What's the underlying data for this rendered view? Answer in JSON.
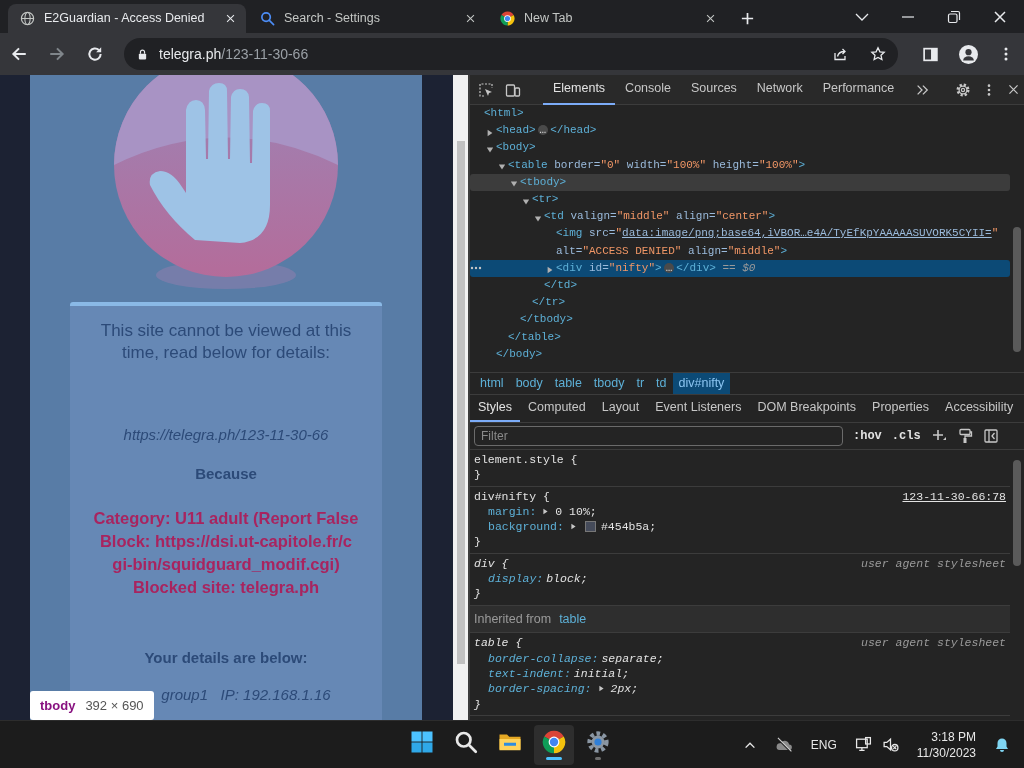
{
  "browser_tabs": [
    {
      "title": "E2Guardian - Access Denied",
      "selected": true
    },
    {
      "title": "Search - Settings",
      "selected": false
    },
    {
      "title": "New Tab",
      "selected": false
    }
  ],
  "address_bar": {
    "host": "telegra.ph",
    "path": "/123-11-30-66"
  },
  "page": {
    "message": "This site cannot be viewed at this time, read below for details:",
    "url": "https://telegra.ph/123-11-30-66",
    "because": "Because",
    "reason_lines": [
      "Category: U11 adult (Report False",
      "Block: https://dsi.ut-capitole.fr/c",
      "gi-bin/squidguard_modif.cgi)",
      "Blocked site: telegra.ph"
    ],
    "details_heading": "Your details are below:",
    "details_line": "group1   IP: 192.168.1.16"
  },
  "inspect_tooltip": {
    "tag": "tbody",
    "size": "392 × 690"
  },
  "devtools": {
    "panels": [
      {
        "label": "Elements",
        "selected": true
      },
      {
        "label": "Console",
        "selected": false
      },
      {
        "label": "Sources",
        "selected": false
      },
      {
        "label": "Network",
        "selected": false
      },
      {
        "label": "Performance",
        "selected": false
      }
    ],
    "dom_tree": [
      {
        "parts": [
          {
            "kind": "tag",
            "text": "<html>"
          }
        ],
        "selected": false,
        "hovered": false,
        "children": [
          {
            "parts": [
              {
                "kind": "tag",
                "text": "<head>"
              },
              {
                "kind": "ellipsis",
                "text": "…"
              },
              {
                "kind": "tag",
                "text": "</head>"
              }
            ],
            "expanded": false,
            "selected": false,
            "hovered": false
          },
          {
            "parts": [
              {
                "kind": "tag",
                "text": "<body>"
              }
            ],
            "expanded": true,
            "selected": false,
            "hovered": false,
            "close": "</body>",
            "children": [
              {
                "parts": [
                  {
                    "kind": "tag",
                    "text": "<table"
                  },
                  {
                    "kind": "attr",
                    "text": " border="
                  },
                  {
                    "kind": "value",
                    "text": "\"0\""
                  },
                  {
                    "kind": "attr",
                    "text": " width="
                  },
                  {
                    "kind": "value",
                    "text": "\"100%\""
                  },
                  {
                    "kind": "attr",
                    "text": " height="
                  },
                  {
                    "kind": "value",
                    "text": "\"100%\""
                  },
                  {
                    "kind": "tag",
                    "text": ">"
                  }
                ],
                "expanded": true,
                "selected": false,
                "hovered": false,
                "close": "</table>",
                "children": [
                  {
                    "parts": [
                      {
                        "kind": "tag",
                        "text": "<tbody>"
                      }
                    ],
                    "expanded": true,
                    "selected": false,
                    "hovered": true,
                    "close": "</tbody>",
                    "children": [
                      {
                        "parts": [
                          {
                            "kind": "tag",
                            "text": "<tr>"
                          }
                        ],
                        "expanded": true,
                        "selected": false,
                        "hovered": false,
                        "close": "</tr>",
                        "children": [
                          {
                            "parts": [
                              {
                                "kind": "tag",
                                "text": "<td"
                              },
                              {
                                "kind": "attr",
                                "text": " valign="
                              },
                              {
                                "kind": "value",
                                "text": "\"middle\""
                              },
                              {
                                "kind": "attr",
                                "text": " align="
                              },
                              {
                                "kind": "value",
                                "text": "\"center\""
                              },
                              {
                                "kind": "tag",
                                "text": ">"
                              }
                            ],
                            "expanded": true,
                            "selected": false,
                            "hovered": false,
                            "close": "</td>",
                            "children": [
                              {
                                "parts": [
                                  {
                                    "kind": "tag",
                                    "text": "<img"
                                  },
                                  {
                                    "kind": "attr",
                                    "text": " src="
                                  },
                                  {
                                    "kind": "value",
                                    "text": "\""
                                  },
                                  {
                                    "kind": "link",
                                    "text": "data:image/png;base64,iVBOR…e4A/TyEfKpYAAAAASUVORK5CYII="
                                  },
                                  {
                                    "kind": "value",
                                    "text": "\""
                                  },
                                  {
                                    "kind": "break"
                                  },
                                  {
                                    "kind": "attr",
                                    "text": "alt="
                                  },
                                  {
                                    "kind": "value",
                                    "text": "\"ACCESS DENIED\""
                                  },
                                  {
                                    "kind": "attr",
                                    "text": " align="
                                  },
                                  {
                                    "kind": "value",
                                    "text": "\"middle\""
                                  },
                                  {
                                    "kind": "tag",
                                    "text": ">"
                                  }
                                ],
                                "selected": false,
                                "hovered": false
                              },
                              {
                                "parts": [
                                  {
                                    "kind": "tag",
                                    "text": "<div"
                                  },
                                  {
                                    "kind": "attr",
                                    "text": " id="
                                  },
                                  {
                                    "kind": "value",
                                    "text": "\"nifty\""
                                  },
                                  {
                                    "kind": "tag",
                                    "text": ">"
                                  },
                                  {
                                    "kind": "ellipsis",
                                    "text": "…"
                                  },
                                  {
                                    "kind": "tag",
                                    "text": "</div>"
                                  },
                                  {
                                    "kind": "plain",
                                    "text": " == "
                                  },
                                  {
                                    "kind": "ref",
                                    "text": "$0"
                                  }
                                ],
                                "expanded": false,
                                "selected": true,
                                "hovered": false
                              }
                            ]
                          }
                        ]
                      }
                    ]
                  }
                ]
              }
            ]
          }
        ]
      }
    ],
    "breadcrumbs": [
      {
        "label": "html",
        "selected": false
      },
      {
        "label": "body",
        "selected": false
      },
      {
        "label": "table",
        "selected": false
      },
      {
        "label": "tbody",
        "selected": false
      },
      {
        "label": "tr",
        "selected": false
      },
      {
        "label": "td",
        "selected": false
      },
      {
        "label": "div#nifty",
        "selected": true
      }
    ],
    "style_tabs": [
      {
        "label": "Styles",
        "selected": true
      },
      {
        "label": "Computed",
        "selected": false
      },
      {
        "label": "Layout",
        "selected": false
      },
      {
        "label": "Event Listeners",
        "selected": false
      },
      {
        "label": "DOM Breakpoints",
        "selected": false
      },
      {
        "label": "Properties",
        "selected": false
      },
      {
        "label": "Accessibility",
        "selected": false
      }
    ],
    "filter": {
      "placeholder": "Filter"
    },
    "style_toggles": [
      ":hov",
      ".cls"
    ],
    "rules": [
      {
        "kind": "rule",
        "selector": "element.style {",
        "close": "}",
        "user_agent": false
      },
      {
        "kind": "rule",
        "selector": "div#nifty {",
        "source": "123-11-30-66:78",
        "user_agent": false,
        "close": "}",
        "declarations": [
          {
            "property": "margin:",
            "value": "0 10%;",
            "expandable": true
          },
          {
            "property": "background:",
            "value": "#454b5a;",
            "expandable": true,
            "color": "#454b5a"
          }
        ]
      },
      {
        "kind": "rule",
        "selector": "div {",
        "source": "user agent stylesheet",
        "user_agent": true,
        "close": "}",
        "declarations": [
          {
            "property": "display:",
            "value": "block;",
            "expandable": false
          }
        ]
      },
      {
        "kind": "inherited",
        "label": "Inherited from",
        "from": "table"
      },
      {
        "kind": "rule",
        "selector": "table {",
        "source": "user agent stylesheet",
        "user_agent": true,
        "close": "}",
        "declarations": [
          {
            "property": "border-collapse:",
            "value": "separate;",
            "expandable": false
          },
          {
            "property": "text-indent:",
            "value": "initial;",
            "expandable": false
          },
          {
            "property": "border-spacing:",
            "value": "2px;",
            "expandable": true
          }
        ]
      }
    ]
  },
  "taskbar": {
    "apps": [
      {
        "kind": "start",
        "running": false
      },
      {
        "kind": "search",
        "running": false
      },
      {
        "kind": "folder",
        "running": false
      },
      {
        "kind": "chrome",
        "running": true,
        "focused": true
      },
      {
        "kind": "settings",
        "running": true,
        "focused": false
      }
    ],
    "language": "ENG",
    "time": "3:18 PM",
    "date": "11/30/2023"
  }
}
